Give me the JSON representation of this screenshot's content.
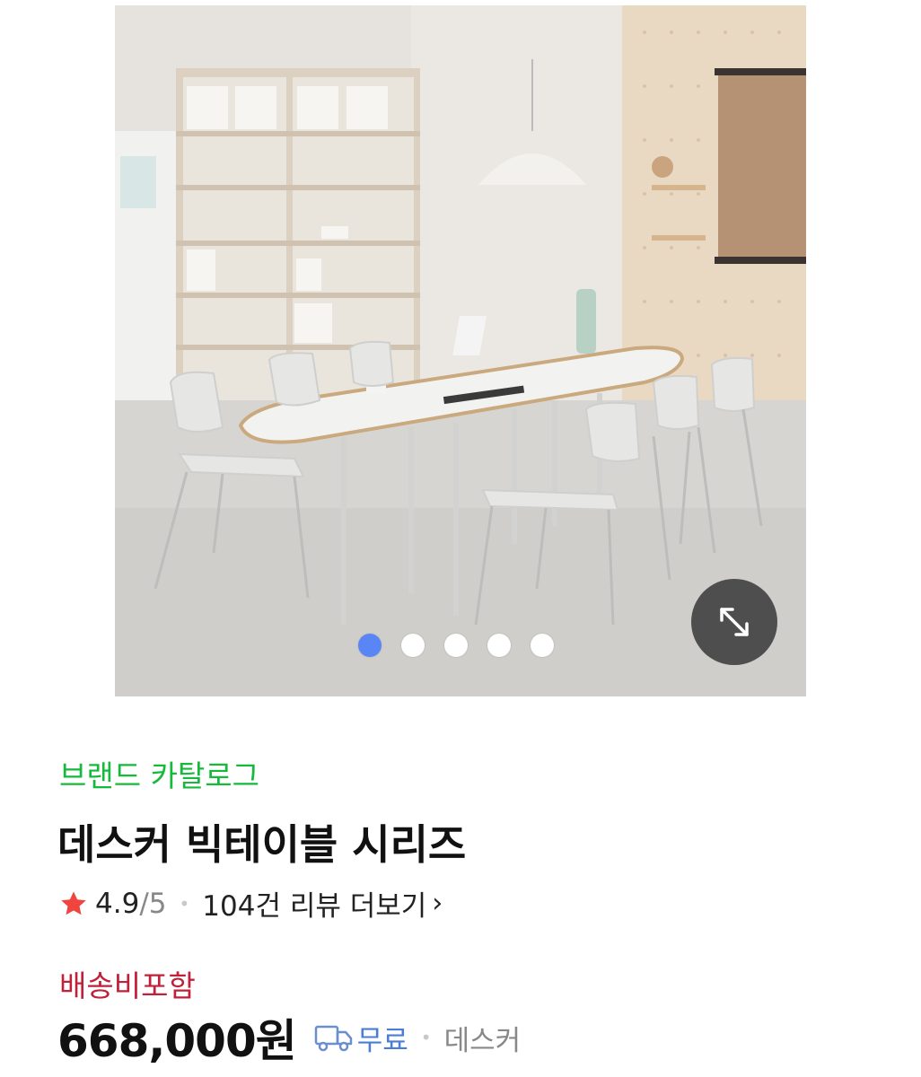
{
  "gallery": {
    "slide_count": 5,
    "active_index": 0,
    "accent_color": "#5a86f5",
    "expand_icon": "expand-arrows-icon"
  },
  "product": {
    "brand_link": "브랜드 카탈로그",
    "title": "데스커 빅테이블 시리즈",
    "rating": {
      "score": "4.9",
      "max": "/5",
      "separator": "•",
      "review_link": "104건 리뷰 더보기",
      "chevron": "›",
      "star_color": "#f0443f"
    },
    "shipping_note": "배송비포함",
    "price": "668,000원",
    "delivery": {
      "icon": "truck-icon",
      "label": "무료",
      "separator": "•",
      "seller": "데스커"
    }
  },
  "colors": {
    "brand_green": "#16b93a",
    "shipping_red": "#c0213a",
    "delivery_blue": "#4a7ed6"
  }
}
